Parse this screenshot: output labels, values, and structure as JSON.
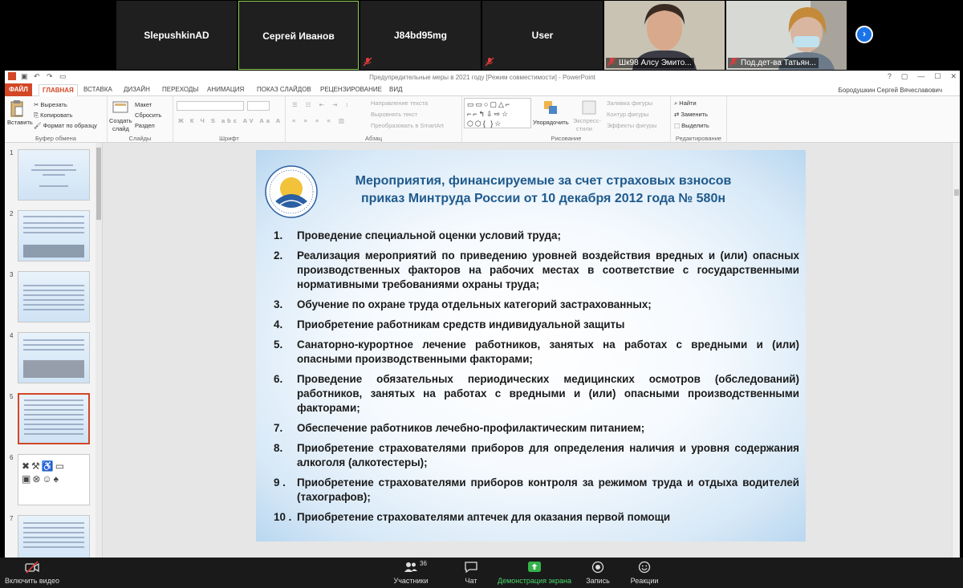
{
  "zoom": {
    "participants_tiles": [
      {
        "name": "SlepushkinAD",
        "active": false,
        "muted": false
      },
      {
        "name": "Сергей Иванов",
        "active": true,
        "muted": false
      },
      {
        "name": "J84bd95mg",
        "active": false,
        "muted": true
      },
      {
        "name": "User",
        "active": false,
        "muted": true
      }
    ],
    "video_tiles": [
      {
        "name": "Шк98 Алсу Эмито..."
      },
      {
        "name": "Под.дет-ва Татьян..."
      }
    ],
    "bottom": {
      "video_label": "Включить видео",
      "participants_label": "Участники",
      "participants_count": "36",
      "chat_label": "Чат",
      "share_label": "Демонстрация экрана",
      "record_label": "Запись",
      "reactions_label": "Реакции"
    }
  },
  "ppt": {
    "window_title": "Предупредительные меры в 2021 году [Режим совместимости] - PowerPoint",
    "user_name": "Бородушкин Сергей Вячеславович",
    "tabs": [
      "ФАЙЛ",
      "ГЛАВНАЯ",
      "ВСТАВКА",
      "ДИЗАЙН",
      "ПЕРЕХОДЫ",
      "АНИМАЦИЯ",
      "ПОКАЗ СЛАЙДОВ",
      "РЕЦЕНЗИРОВАНИЕ",
      "ВИД"
    ],
    "ribbon": {
      "clipboard": {
        "paste": "Вставить",
        "cut": "Вырезать",
        "copy": "Копировать",
        "format": "Формат по образцу",
        "label": "Буфер обмена"
      },
      "slides": {
        "create": "Создать",
        "create2": "слайд",
        "layout": "Макет",
        "reset": "Сбросить",
        "section": "Раздел",
        "label": "Слайды"
      },
      "font": {
        "label": "Шрифт",
        "buttons": "Ж  К  Ч  S  abc  AV  Aa  A"
      },
      "paragraph": {
        "direction": "Направление текста",
        "align": "Выровнять текст",
        "smartart": "Преобразовать в SmartArt",
        "label": "Абзац"
      },
      "drawing": {
        "arrange": "Упорядочить",
        "styles": "Экспресс-",
        "styles2": "стили",
        "fill": "Заливка фигуры",
        "outline": "Контур фигуры",
        "effects": "Эффекты фигуры",
        "label": "Рисование"
      },
      "editing": {
        "find": "Найти",
        "replace": "Заменить",
        "select": "Выделить",
        "label": "Редактирование"
      }
    },
    "thumbnails": [
      "1",
      "2",
      "3",
      "4",
      "5",
      "6",
      "7"
    ],
    "selected_slide": 5,
    "slide": {
      "title_line1": "Мероприятия, финансируемые за счет  страховых взносов",
      "title_line2": "приказ Минтруда России  от 10 декабря 2012 года  № 580н",
      "items": [
        {
          "num": "1.",
          "text": "Проведение специальной оценки условий труда;"
        },
        {
          "num": "2.",
          "text": "Реализация мероприятий по приведению уровней воздействия вредных и (или) опасных производственных факторов на рабочих местах в соответствие с государственными нормативными требованиями охраны труда;"
        },
        {
          "num": "3.",
          "text": "Обучение по охране труда отдельных категорий застрахованных;"
        },
        {
          "num": "4.",
          "text": "Приобретение работникам средств индивидуальной защиты"
        },
        {
          "num": "5.",
          "text": "Санаторно-курортное лечение работников, занятых на работах с вредными и (или) опасными производственными факторами;"
        },
        {
          "num": "6.",
          "text": "Проведение обязательных периодических медицинских осмотров (обследований) работников, занятых на работах с вредными и (или) опасными производственными факторами;"
        },
        {
          "num": "7.",
          "text": "Обеспечение работников лечебно-профилактическим питанием;"
        },
        {
          "num": "8.",
          "text": "Приобретение страхователями приборов для определения наличия и уровня содержания алкоголя (алкотестеры);"
        },
        {
          "num": "9 .",
          "text": "Приобретение страхователями приборов контроля за режимом труда и отдыха водителей (тахографов);"
        },
        {
          "num": "10 .",
          "text": "Приобретение страхователями аптечек для оказания первой помощи"
        }
      ]
    }
  },
  "colors": {
    "ppt_accent": "#d24726",
    "slide_title": "#1f5a8c",
    "zoom_share": "#4bd56b",
    "zoom_next": "#1a73e8"
  }
}
